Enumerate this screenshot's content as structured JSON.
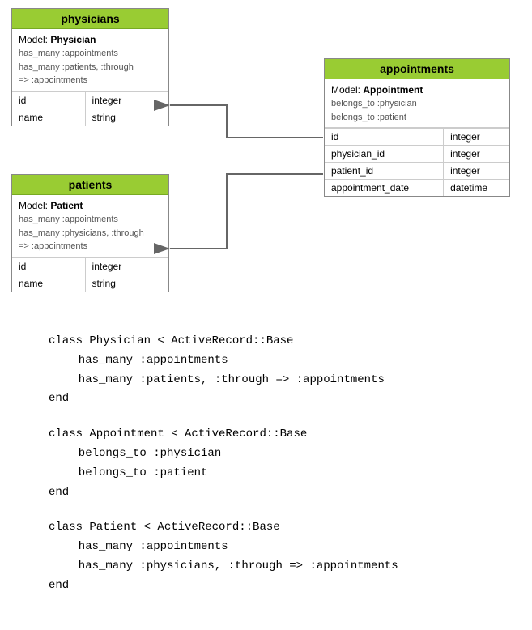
{
  "physicians": {
    "title": "physicians",
    "model_label": "Model:",
    "model_name": "Physician",
    "assoc1": "has_many :appointments",
    "assoc2": "has_many :patients, :through",
    "assoc3": "=> :appointments",
    "rows": [
      {
        "col1": "id",
        "col2": "integer"
      },
      {
        "col1": "name",
        "col2": "string"
      }
    ]
  },
  "appointments": {
    "title": "appointments",
    "model_label": "Model:",
    "model_name": "Appointment",
    "assoc1": "belongs_to :physician",
    "assoc2": "belongs_to :patient",
    "rows": [
      {
        "col1": "id",
        "col2": "integer"
      },
      {
        "col1": "physician_id",
        "col2": "integer"
      },
      {
        "col1": "patient_id",
        "col2": "integer"
      },
      {
        "col1": "appointment_date",
        "col2": "datetime"
      }
    ]
  },
  "patients": {
    "title": "patients",
    "model_label": "Model:",
    "model_name": "Patient",
    "assoc1": "has_many :appointments",
    "assoc2": "has_many :physicians, :through",
    "assoc3": "=> :appointments",
    "rows": [
      {
        "col1": "id",
        "col2": "integer"
      },
      {
        "col1": "name",
        "col2": "string"
      }
    ]
  },
  "code": {
    "blocks": [
      {
        "lines": [
          "class Physician < ActiveRecord::Base",
          "  has_many :appointments",
          "  has_many :patients, :through => :appointments",
          "end"
        ]
      },
      {
        "lines": [
          "class Appointment < ActiveRecord::Base",
          "  belongs_to :physician",
          "  belongs_to :patient",
          "end"
        ]
      },
      {
        "lines": [
          "class Patient < ActiveRecord::Base",
          "  has_many :appointments",
          "  has_many :physicians, :through => :appointments",
          "end"
        ]
      }
    ]
  }
}
